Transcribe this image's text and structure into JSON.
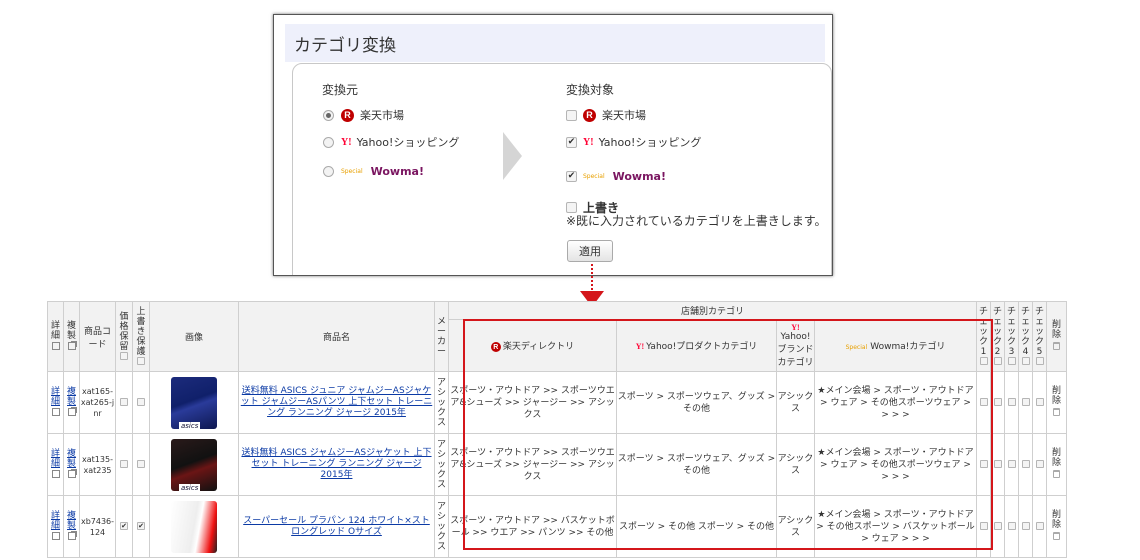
{
  "dialog": {
    "title": "カテゴリ変換",
    "source": {
      "title": "変換元",
      "options": [
        {
          "label": "楽天市場",
          "checked": true,
          "logo": "R"
        },
        {
          "label": "Yahoo!ショッピング",
          "checked": false,
          "logo": "Y!"
        },
        {
          "label": "Wowma!",
          "checked": false,
          "logo": "wowma"
        }
      ]
    },
    "target": {
      "title": "変換対象",
      "options": [
        {
          "label": "楽天市場",
          "checked": false,
          "logo": "R"
        },
        {
          "label": "Yahoo!ショッピング",
          "checked": true,
          "logo": "Y!"
        },
        {
          "label": "Wowma!",
          "checked": true,
          "logo": "wowma"
        }
      ]
    },
    "overwrite": {
      "label": "上書き",
      "checked": false,
      "note": "※既に入力されているカテゴリを上書きします。"
    },
    "apply_label": "適用",
    "logo_text": {
      "r": "R",
      "y": "Y!",
      "w": "Special"
    }
  },
  "table": {
    "headers": {
      "detail": "詳細",
      "copy": "複製",
      "code": "商品コード",
      "price_lock": "価格保留",
      "overwrite_lock": "上書き保護",
      "image": "画像",
      "name": "商品名",
      "maker": "メーカー",
      "store_category": "店舗別カテゴリ",
      "rakuten": "楽天ディレクトリ",
      "yahoo": "Yahoo!プロダクトカテゴリ",
      "yahoo_brand": "Yahoo!ブランドカテゴリ",
      "wowma": "Wowma!カテゴリ",
      "check": "チェック",
      "checks": [
        "1",
        "2",
        "3",
        "4",
        "5"
      ],
      "delete": "削除"
    },
    "rows": [
      {
        "detail": "詳細",
        "copy": "複製",
        "code": "xat165-xat265-jnr",
        "price_lock": false,
        "overwrite_lock": false,
        "name": "送料無料 ASICS ジュニア ジャムジーASジャケット ジャムジーASパンツ 上下セット トレーニング ランニング ジャージ 2015年",
        "maker": "アシックス",
        "rakuten": "スポーツ・アウトドア >> スポーツウエア&シューズ >> ジャージー >> アシックス",
        "yahoo": "スポーツ > スポーツウェア、グッズ > その他",
        "yahoo_brand": "アシックス",
        "wowma": "★メイン会場 > スポーツ・アウトドア > ウェア > その他スポーツウェア > > > >",
        "delete": "削除",
        "thumb_label": "asics"
      },
      {
        "detail": "詳細",
        "copy": "複製",
        "code": "xat135-xat235",
        "price_lock": false,
        "overwrite_lock": false,
        "name": "送料無料 ASICS ジャムジーASジャケット 上下セット トレーニング ランニング ジャージ 2015年",
        "maker": "アシックス",
        "rakuten": "スポーツ・アウトドア >> スポーツウエア&シューズ >> ジャージー >> アシックス",
        "yahoo": "スポーツ > スポーツウェア、グッズ > その他",
        "yahoo_brand": "アシックス",
        "wowma": "★メイン会場 > スポーツ・アウトドア > ウェア > その他スポーツウェア > > > >",
        "delete": "削除",
        "thumb_label": "asics"
      },
      {
        "detail": "詳細",
        "copy": "複製",
        "code": "xb7436-124",
        "price_lock": true,
        "overwrite_lock": true,
        "name": "スーパーセール プラパン 124 ホワイト×ストロングレッド Oサイズ",
        "maker": "アシックス",
        "rakuten": "スポーツ・アウトドア >> バスケットボール >> ウエア >> パンツ >> その他",
        "yahoo": "スポーツ > その他 スポーツ > その他",
        "yahoo_brand": "アシックス",
        "wowma": "★メイン会場 > スポーツ・アウトドア > その他スポーツ > バスケットボール > ウェア > > >",
        "delete": "削除",
        "thumb_label": ""
      }
    ]
  },
  "colors": {
    "accent_red": "#d4161b",
    "header_bg": "#eef0fb",
    "link": "#0b3aa5"
  }
}
